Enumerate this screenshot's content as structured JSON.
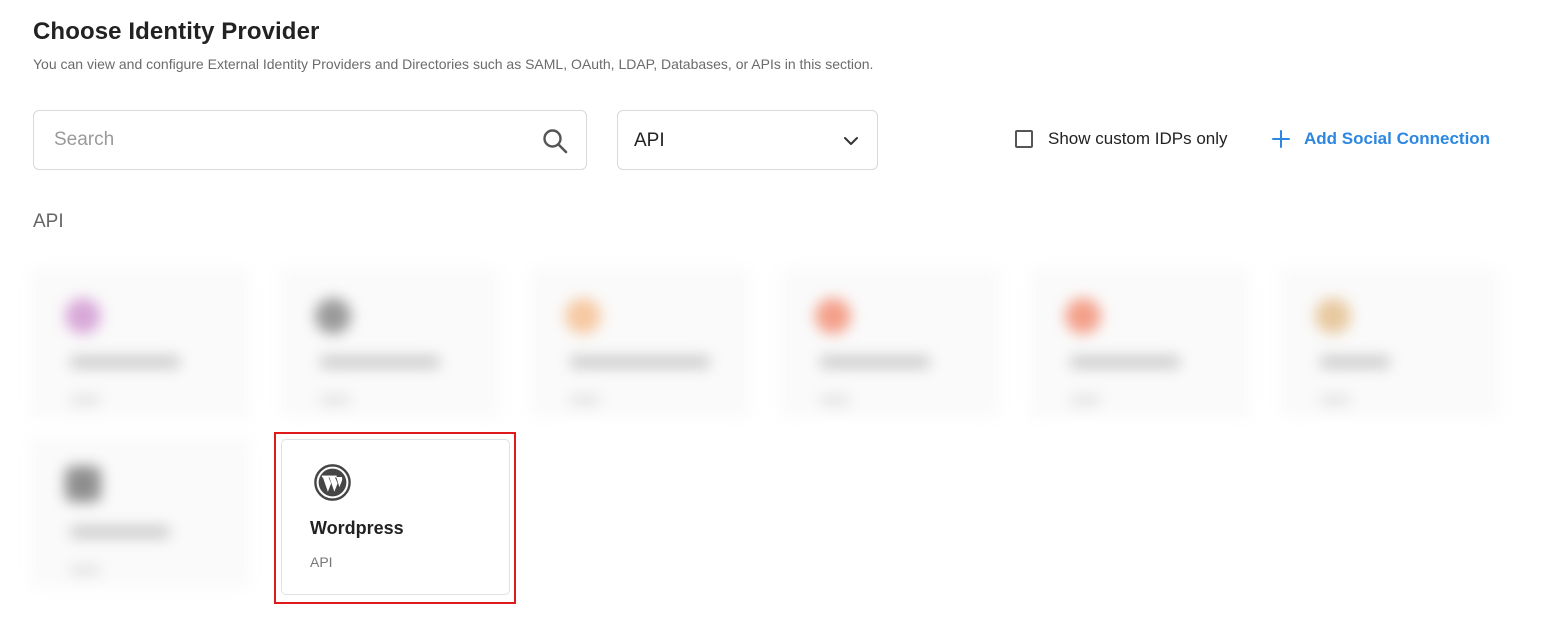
{
  "header": {
    "title": "Choose Identity Provider",
    "subtitle": "You can view and configure External Identity Providers and Directories such as SAML, OAuth, LDAP, Databases, or APIs in this section."
  },
  "search": {
    "placeholder": "Search",
    "value": "",
    "icon": "search-icon"
  },
  "filter": {
    "selected": "API",
    "icon": "chevron-down-icon"
  },
  "custom_filter": {
    "label": "Show custom IDPs only",
    "checked": false
  },
  "add_social": {
    "label": "Add Social Connection",
    "icon": "plus-icon",
    "color": "#2d87e0"
  },
  "section": {
    "label": "API"
  },
  "cards": [
    {
      "name": "Wordpress",
      "type": "API",
      "icon": "wordpress-icon",
      "highlighted": true,
      "highlight_color": "#e01a1a"
    }
  ]
}
